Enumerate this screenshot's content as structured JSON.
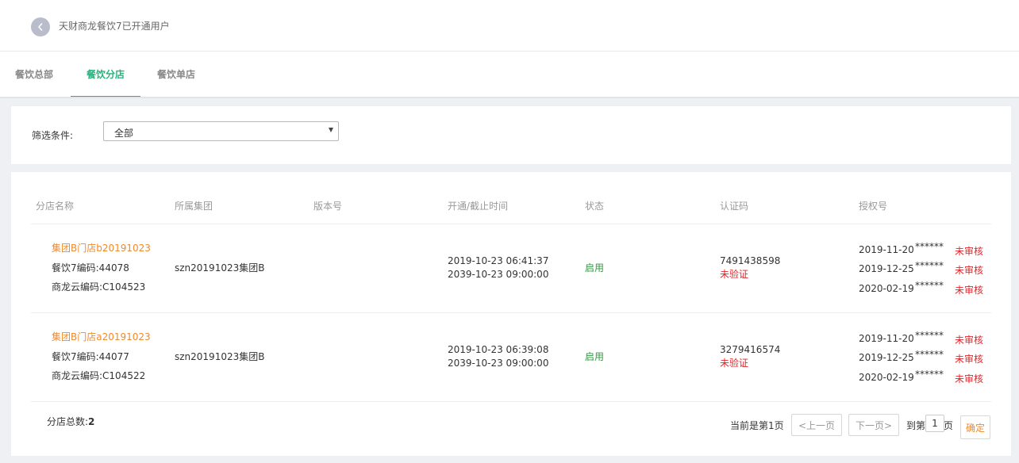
{
  "header": {
    "title": "天财商龙餐饮7已开通用户"
  },
  "tabs": [
    {
      "label": "餐饮总部",
      "active": false
    },
    {
      "label": "餐饮分店",
      "active": true
    },
    {
      "label": "餐饮单店",
      "active": false
    }
  ],
  "filter": {
    "label": "筛选条件:",
    "selected": "全部"
  },
  "table": {
    "headers": [
      "分店名称",
      "所属集团",
      "版本号",
      "开通/截止时间",
      "状态",
      "认证码",
      "授权号"
    ],
    "rows": [
      {
        "name": "集团B门店b20191023",
        "code7": "餐饮7编码:44078",
        "cloud_code": "商龙云编码:C104523",
        "group": "szn20191023集团B",
        "version": "",
        "open_time": "2019-10-23 06:41:37",
        "end_time": "2039-10-23 09:00:00",
        "status": "启用",
        "cert_code": "7491438598",
        "cert_status": "未验证",
        "auth": [
          {
            "date": "2019-11-20",
            "mask": "******",
            "state": "未审核"
          },
          {
            "date": "2019-12-25",
            "mask": "******",
            "state": "未审核"
          },
          {
            "date": "2020-02-19",
            "mask": "******",
            "state": "未审核"
          }
        ]
      },
      {
        "name": "集团B门店a20191023",
        "code7": "餐饮7编码:44077",
        "cloud_code": "商龙云编码:C104522",
        "group": "szn20191023集团B",
        "version": "",
        "open_time": "2019-10-23 06:39:08",
        "end_time": "2039-10-23 09:00:00",
        "status": "启用",
        "cert_code": "3279416574",
        "cert_status": "未验证",
        "auth": [
          {
            "date": "2019-11-20",
            "mask": "******",
            "state": "未审核"
          },
          {
            "date": "2019-12-25",
            "mask": "******",
            "state": "未审核"
          },
          {
            "date": "2020-02-19",
            "mask": "******",
            "state": "未审核"
          }
        ]
      }
    ]
  },
  "footer": {
    "total_label": "分店总数:",
    "total_value": "2",
    "page_info": "当前是第1页",
    "prev_label": "<上一页",
    "next_label": "下一页>",
    "goto_label": "到第",
    "goto_value": "1",
    "goto_suffix": "页",
    "confirm_label": "确定"
  },
  "colors": {
    "accent": "#2bb07e",
    "link": "#f08a2c",
    "enabled": "#2e9b3e",
    "warning": "#e0262b"
  }
}
